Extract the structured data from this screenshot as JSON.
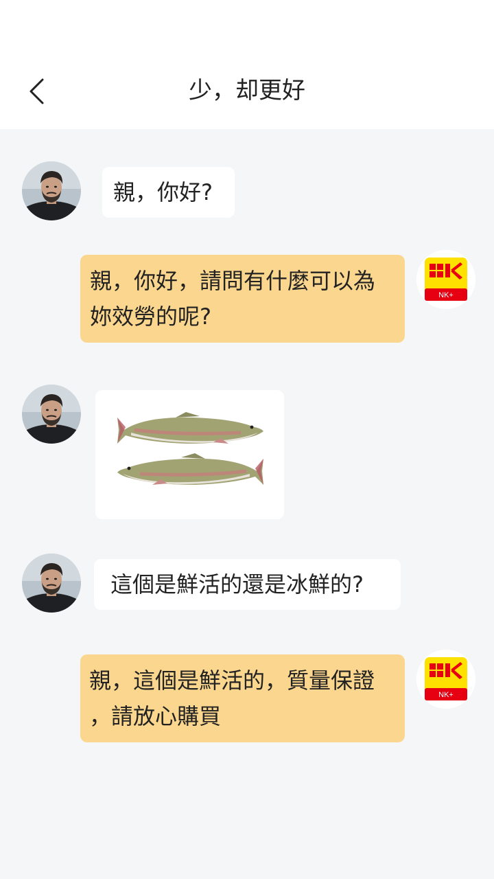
{
  "header": {
    "title": "少，却更好",
    "back_icon": "chevron-left-icon"
  },
  "avatars": {
    "customer_icon": "person-avatar",
    "shop_icon": "nk-plus-logo",
    "shop_logo_text": "NK+"
  },
  "messages": [
    {
      "sender": "customer",
      "type": "text",
      "text": "親，你好?"
    },
    {
      "sender": "shop",
      "type": "text",
      "lines": [
        "親，你好，請問有什麼可以為",
        "妳效勞的呢?"
      ]
    },
    {
      "sender": "customer",
      "type": "image",
      "image": "two-trout-fish-photo"
    },
    {
      "sender": "customer",
      "type": "text",
      "text": "這個是鮮活的還是冰鮮的?"
    },
    {
      "sender": "shop",
      "type": "text",
      "lines": [
        "親，這個是鮮活的，質量保證",
        "，請放心購買"
      ]
    }
  ],
  "colors": {
    "background": "#f5f6f8",
    "outgoing_bubble": "#fbd68e",
    "incoming_bubble": "#ffffff",
    "logo_yellow": "#ffe100",
    "logo_red": "#e60012"
  }
}
